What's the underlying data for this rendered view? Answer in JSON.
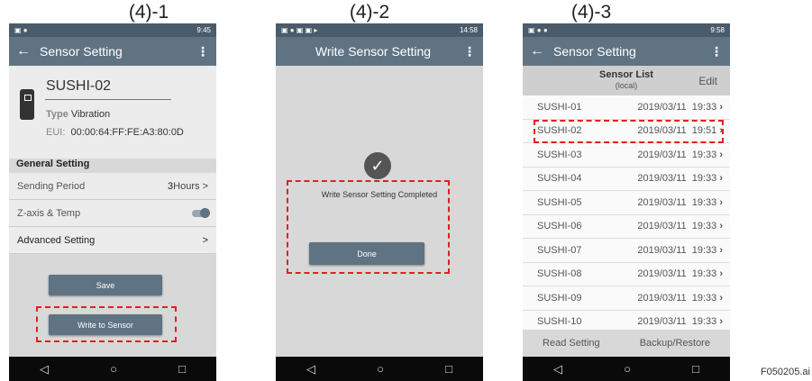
{
  "captions": [
    "(4)-1",
    "(4)-2",
    "(4)-3"
  ],
  "nav": {
    "back": "◁",
    "home": "○",
    "recent": "□"
  },
  "phone1": {
    "status_time": "9:45",
    "title": "Sensor Setting",
    "sensor_name": "SUSHI-02",
    "type_label": "Type",
    "type_value": "Vibration",
    "eui_label": "EUI:",
    "eui_value": "00:00:64:FF:FE:A3:80:0D",
    "section": "General Setting",
    "rows": [
      {
        "label": "Sending Period",
        "value_num": "3",
        "value_unit": "Hours",
        "chevron": ">"
      },
      {
        "label": "Z-axis & Temp"
      },
      {
        "label": "Advanced Setting",
        "chevron": ">"
      }
    ],
    "save_label": "Save",
    "write_label": "Write to Sensor"
  },
  "phone2": {
    "status_time": "14:58",
    "title": "Write Sensor Setting",
    "message": "Write Sensor Setting Completed",
    "done_label": "Done"
  },
  "phone3": {
    "status_time": "9:58",
    "title": "Sensor Setting",
    "list_title": "Sensor List",
    "list_subtitle": "(local)",
    "edit_label": "Edit",
    "items": [
      {
        "name": "SUSHI-01",
        "date": "2019/03/11  19:33"
      },
      {
        "name": "SUSHI-02",
        "date": "2019/03/11  19:51"
      },
      {
        "name": "SUSHI-03",
        "date": "2019/03/11  19:33"
      },
      {
        "name": "SUSHI-04",
        "date": "2019/03/11  19:33"
      },
      {
        "name": "SUSHI-05",
        "date": "2019/03/11  19:33"
      },
      {
        "name": "SUSHI-06",
        "date": "2019/03/11  19:33"
      },
      {
        "name": "SUSHI-07",
        "date": "2019/03/11  19:33"
      },
      {
        "name": "SUSHI-08",
        "date": "2019/03/11  19:33"
      },
      {
        "name": "SUSHI-09",
        "date": "2019/03/11  19:33"
      },
      {
        "name": "SUSHI-10",
        "date": "2019/03/11  19:33"
      }
    ],
    "read_label": "Read Setting",
    "backup_label": "Backup/Restore"
  },
  "figure_id": "F050205.ai",
  "colors": {
    "appbar": "#5f7383",
    "highlight": "#e02020"
  }
}
